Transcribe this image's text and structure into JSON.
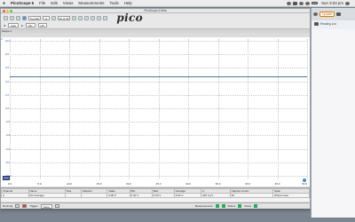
{
  "menubar": {
    "app": "PicoScope 6",
    "items": [
      "File",
      "Edit",
      "Views",
      "Measurements",
      "Tools",
      "Help"
    ],
    "clock": "Sun 3:33 pm"
  },
  "window": {
    "title": "PicoScope 6 Beta",
    "logo": "pico"
  },
  "toolbar1": {
    "timebase": "5 µs/div",
    "zoom": "x1",
    "capture_count": "32 of 32"
  },
  "toolbar2": {
    "channel_a_range": "Auto",
    "coupling": "DC",
    "probe_off": "Off"
  },
  "scope_label": "Scope 1",
  "y_unit": "V",
  "y_ticks": [
    "10.0",
    "8.0",
    "6.0",
    "4.0",
    "2.0",
    "0.0",
    "-2.0",
    "-4.0",
    "-6.0",
    "-8.0",
    "-10.0"
  ],
  "x_ticks": [
    "0.0",
    "5.0",
    "10.0",
    "15.0",
    "20.0",
    "25.0",
    "30.0",
    "35.0",
    "40.0",
    "45.0",
    "50.0"
  ],
  "x_unit": "µs",
  "measurements": {
    "headers": [
      "Channel",
      "Name",
      "Test",
      "Failures",
      "Value",
      "Min",
      "Max",
      "Average",
      "σ",
      "Capture Count",
      "Span"
    ],
    "rows": [
      [
        "A",
        "DC Average",
        "",
        "",
        "5.00 V",
        "5.00 V",
        "5.00 V",
        "5.00 V",
        "387.3 μV",
        "32",
        "Whole trace"
      ]
    ]
  },
  "status": {
    "running": "Running",
    "trigger": "Trigger",
    "trigger_mode": "None",
    "measurements": "Measurements",
    "rulers": "Rulers",
    "notes": "Notes"
  },
  "browser": {
    "update": "Update",
    "tab": "Reading List"
  }
}
